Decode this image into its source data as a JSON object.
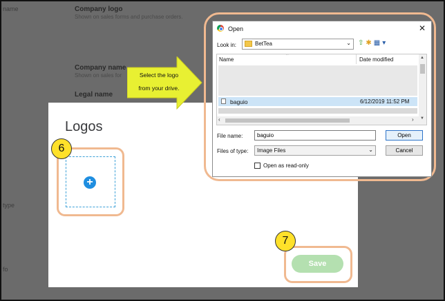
{
  "background": {
    "left_labels": [
      "name",
      "type",
      "fo"
    ],
    "company_logo_title": "Company logo",
    "company_logo_desc": "Shown on sales forms and purchase orders.",
    "company_name_title": "Company name",
    "company_name_desc": "Shown on sales for",
    "legal_name_title": "Legal name"
  },
  "logos_modal": {
    "title": "Logos",
    "add_icon": "plus-circle-icon",
    "save_label": "Save"
  },
  "callout": {
    "line1": "Select the logo",
    "line2": "from your drive."
  },
  "steps": {
    "upload": "6",
    "save": "7"
  },
  "open_dialog": {
    "title": "Open",
    "close_glyph": "✕",
    "look_in_label": "Look in:",
    "look_in_value": "BetTea",
    "columns": {
      "name": "Name",
      "date_modified": "Date modified"
    },
    "files": [
      {
        "name": "baguio",
        "date_modified": "6/12/2019 11:52 PM"
      }
    ],
    "file_name_label": "File name:",
    "file_name_value": "baguio",
    "files_of_type_label": "Files of type:",
    "files_of_type_value": "Image Files",
    "open_label": "Open",
    "cancel_label": "Cancel",
    "read_only_label": "Open as read-only"
  },
  "colors": {
    "accent_blue": "#1f8ee0",
    "save_green": "#b4e0b0",
    "highlight_ring": "#f0b990",
    "step_badge": "#ffe12a",
    "callout_arrow": "#e8f032"
  }
}
